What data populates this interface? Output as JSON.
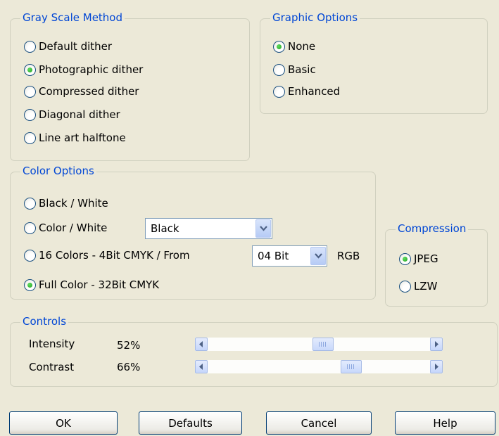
{
  "gray_scale": {
    "legend": "Gray Scale Method",
    "options": [
      {
        "label": "Default dither",
        "checked": false
      },
      {
        "label": "Photographic dither",
        "checked": true
      },
      {
        "label": "Compressed dither",
        "checked": false
      },
      {
        "label": "Diagonal dither",
        "checked": false
      },
      {
        "label": "Line art halftone",
        "checked": false
      }
    ]
  },
  "graphic_options": {
    "legend": "Graphic Options",
    "options": [
      {
        "label": "None",
        "checked": true
      },
      {
        "label": "Basic",
        "checked": false
      },
      {
        "label": "Enhanced",
        "checked": false
      }
    ]
  },
  "color_options": {
    "legend": "Color Options",
    "options": [
      {
        "label": "Black / White",
        "checked": false
      },
      {
        "label": "Color / White",
        "checked": false
      },
      {
        "label": "16 Colors - 4Bit CMYK / From",
        "checked": false
      },
      {
        "label": "Full Color - 32Bit CMYK",
        "checked": true
      }
    ],
    "color_select_value": "Black",
    "bit_select_value": "04 Bit",
    "rgb_label": "RGB"
  },
  "compression": {
    "legend": "Compression",
    "options": [
      {
        "label": "JPEG",
        "checked": true
      },
      {
        "label": "LZW",
        "checked": false
      }
    ]
  },
  "controls": {
    "legend": "Controls",
    "intensity": {
      "label": "Intensity",
      "value_text": "52%",
      "value": 0.52
    },
    "contrast": {
      "label": "Contrast",
      "value_text": "66%",
      "value": 0.66
    }
  },
  "buttons": {
    "ok": "OK",
    "defaults": "Defaults",
    "cancel": "Cancel",
    "help": "Help"
  },
  "icons": {
    "dropdown": "chevron-down-icon",
    "scroll_left": "arrow-left-icon",
    "scroll_right": "arrow-right-icon"
  },
  "colors": {
    "legend_text": "#0046d5",
    "window_bg": "#ece9d8",
    "radio_dot": "#21a121"
  }
}
